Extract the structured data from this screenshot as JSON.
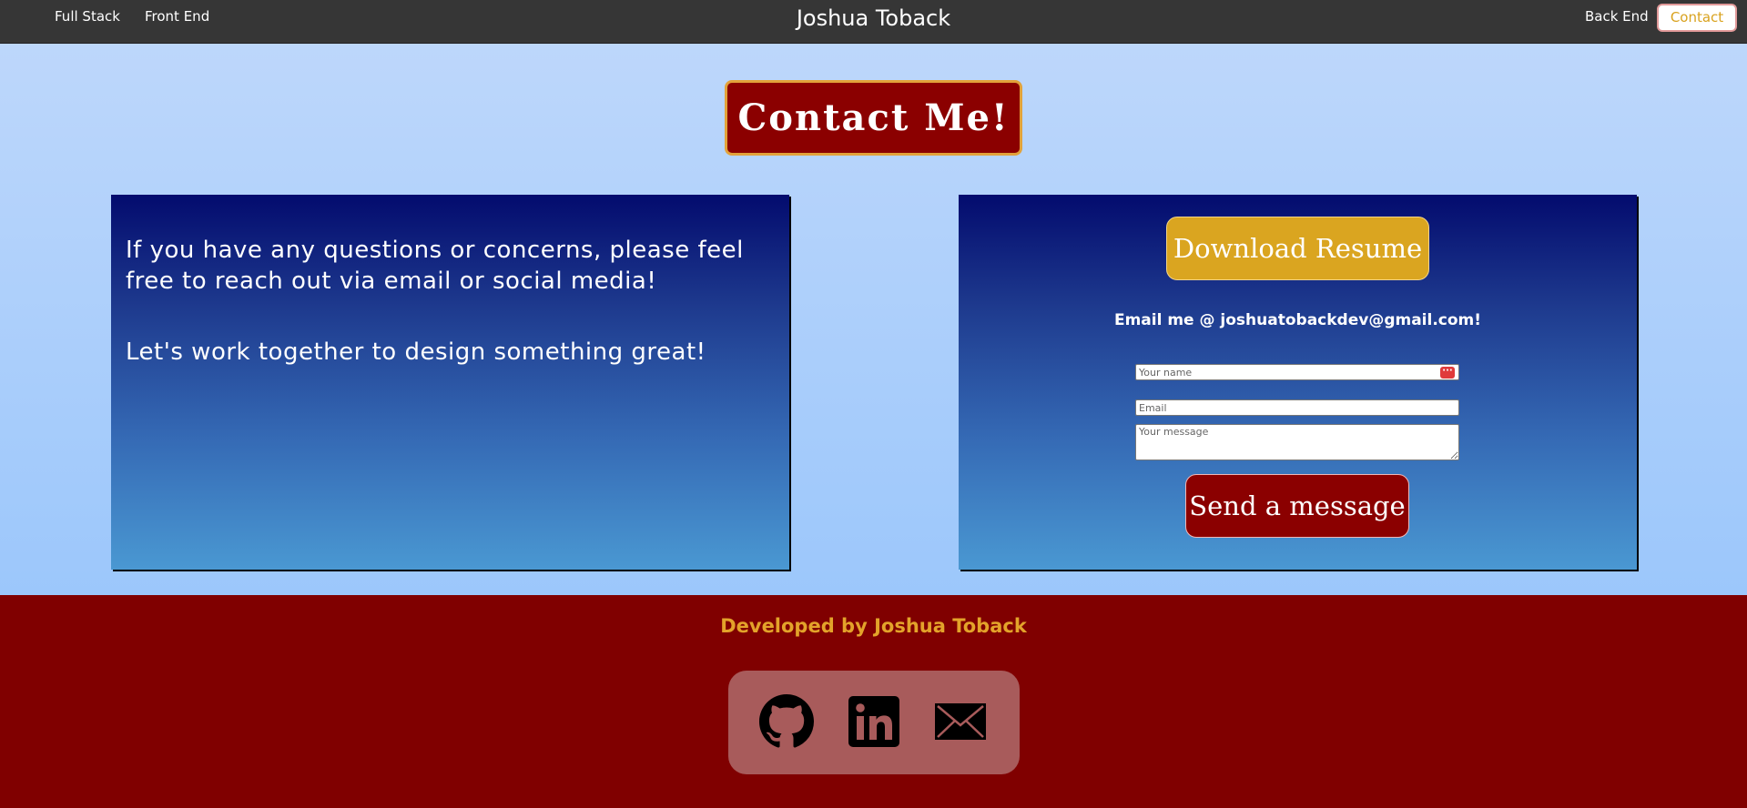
{
  "nav": {
    "brand": "Joshua Toback",
    "links": [
      "Full Stack",
      "Front End",
      "Back End"
    ],
    "contact": "Contact"
  },
  "main": {
    "heading": "Contact Me!",
    "intro": "If you have any questions or concerns, please feel free to reach out via email or social media!",
    "outro": "Let's work together to design something great!",
    "resume_button": "Download Resume",
    "email_line": "Email me @ joshuatobackdev@gmail.com!",
    "form": {
      "name_placeholder": "Your name",
      "email_placeholder": "Email",
      "message_placeholder": "Your message",
      "send_button": "Send a message"
    }
  },
  "footer": {
    "credit": "Developed by Joshua Toback",
    "social": [
      "github-icon",
      "linkedin-icon",
      "mail-icon"
    ]
  },
  "colors": {
    "navbar": "#363636",
    "accent_red": "#8b0000",
    "gold": "#daa520",
    "footer": "#800000"
  }
}
